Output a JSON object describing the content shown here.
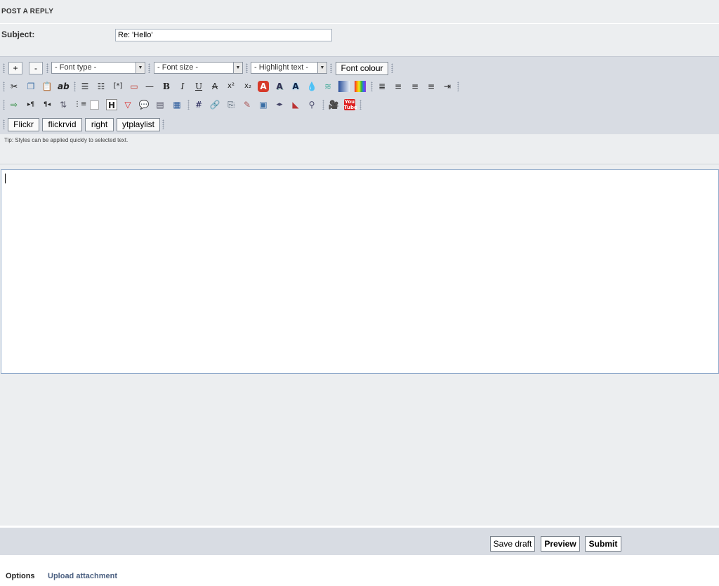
{
  "header": {
    "title": "POST A REPLY"
  },
  "subject": {
    "label": "Subject:",
    "value": "Re: 'Hello'"
  },
  "toolbar": {
    "increase_label": "+",
    "decrease_label": "-",
    "font_type": "- Font type -",
    "font_size": "- Font size -",
    "highlight": "- Highlight text -",
    "font_colour": "Font colour",
    "custom_buttons": [
      "Flickr",
      "flickrvid",
      "right",
      "ytplaylist"
    ],
    "tip": "Tip: Styles can be applied quickly to selected text."
  },
  "icons": {
    "row2": [
      "cut-icon",
      "copy-icon",
      "paste-icon",
      "spellcheck-icon",
      "bullet-list-icon",
      "numbered-list-icon",
      "list-item-icon",
      "code-icon",
      "horizontal-rule-icon",
      "bold-icon",
      "italic-icon",
      "underline-icon",
      "strikethrough-icon",
      "superscript-icon",
      "subscript-icon",
      "outline-text-icon",
      "shadow-text-icon",
      "glow-text-icon",
      "drop-icon",
      "wave-icon",
      "gradient-icon",
      "rainbow-icon",
      "justify-icon",
      "align-left-icon",
      "align-center-icon",
      "align-right-icon",
      "indent-icon"
    ],
    "row3": [
      "insert-icon",
      "ltr-icon",
      "rtl-icon",
      "move-icon",
      "sub-list-icon",
      "blank-icon",
      "heading-icon",
      "spoiler-icon",
      "quote-bubble-icon",
      "document-icon",
      "table-icon",
      "anchor-icon",
      "link-icon",
      "attach-icon",
      "flash-icon",
      "image-icon",
      "media-icon",
      "offtopic-icon",
      "search-icon",
      "video-icon",
      "youtube-icon"
    ]
  },
  "actions": {
    "save_draft": "Save draft",
    "preview": "Preview",
    "submit": "Submit"
  },
  "tabs": {
    "options": "Options",
    "upload": "Upload attachment"
  },
  "colors": {
    "panel": "#eceef0",
    "toolbar": "#d8dce3",
    "tab_link": "#4a5f80"
  }
}
